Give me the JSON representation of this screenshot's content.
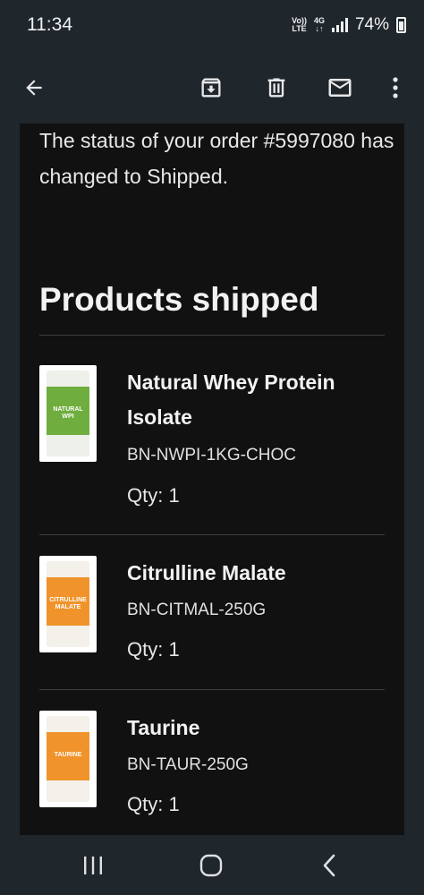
{
  "status_bar": {
    "time": "11:34",
    "volte_top": "Vo))",
    "volte_bottom": "LTE",
    "network_top": "4G",
    "network_bottom": "↓↑",
    "battery": "74%",
    "icons": [
      "volte-icon",
      "4g-icon",
      "signal-icon",
      "battery-icon"
    ]
  },
  "toolbar": {
    "icons": [
      "back-arrow-icon",
      "archive-icon",
      "delete-icon",
      "mark-unread-icon",
      "more-options-icon"
    ]
  },
  "email": {
    "status_message": "The status of your order #5997080 has changed to Shipped.",
    "section_title": "Products shipped",
    "products": [
      {
        "name": "Natural Whey Protein Isolate",
        "sku": "BN-NWPI-1KG-CHOC",
        "qty": "Qty: 1",
        "image_label": "NATURAL WPI",
        "image_color": "#6fae3e"
      },
      {
        "name": "Citrulline Malate",
        "sku": "BN-CITMAL-250G",
        "qty": "Qty: 1",
        "image_label": "CITRULLINE MALATE",
        "image_color": "#f0932b"
      },
      {
        "name": "Taurine",
        "sku": "BN-TAUR-250G",
        "qty": "Qty: 1",
        "image_label": "TAURINE",
        "image_color": "#f0932b"
      }
    ]
  },
  "nav_bar": {
    "icons": [
      "recent-apps-icon",
      "home-icon",
      "back-icon"
    ]
  }
}
